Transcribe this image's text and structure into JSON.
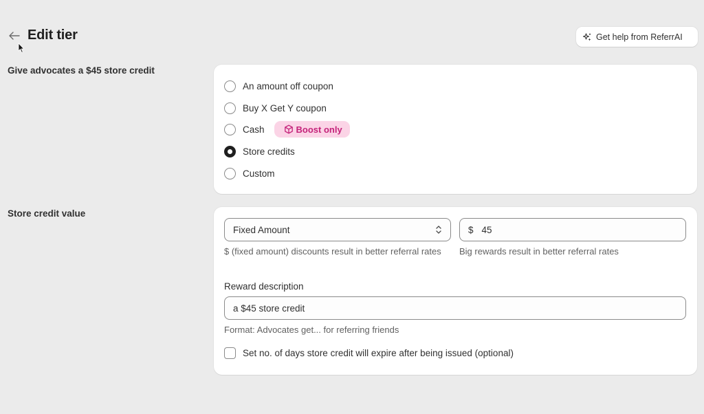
{
  "header": {
    "back_icon": "arrow-left-icon",
    "title": "Edit tier",
    "help_button": {
      "label": "Get help from ReferrAI",
      "icon": "sparkles-icon"
    }
  },
  "reward_type": {
    "section_label": "Give advocates a $45 store credit",
    "options": [
      {
        "label": "An amount off coupon",
        "checked": false
      },
      {
        "label": "Buy X Get Y coupon",
        "checked": false
      },
      {
        "label": "Cash",
        "checked": false,
        "badge": "Boost only",
        "badge_icon": "cube-icon"
      },
      {
        "label": "Store credits",
        "checked": true
      },
      {
        "label": "Custom",
        "checked": false
      }
    ]
  },
  "store_credit": {
    "section_label": "Store credit value",
    "amount_type": {
      "value": "Fixed Amount",
      "help": "$ (fixed amount) discounts result in better referral rates"
    },
    "amount": {
      "prefix": "$",
      "value": "45",
      "help": "Big rewards result in better referral rates"
    },
    "reward_description": {
      "label": "Reward description",
      "value": "a $45 store credit",
      "help": "Format: Advocates get... for referring friends"
    },
    "expiry_checkbox": {
      "label": "Set no. of days store credit will expire after being issued (optional)",
      "checked": false
    }
  },
  "colors": {
    "background": "#ebebeb",
    "card": "#ffffff",
    "badge_bg": "#fbd4e6",
    "badge_text": "#c4237a"
  }
}
